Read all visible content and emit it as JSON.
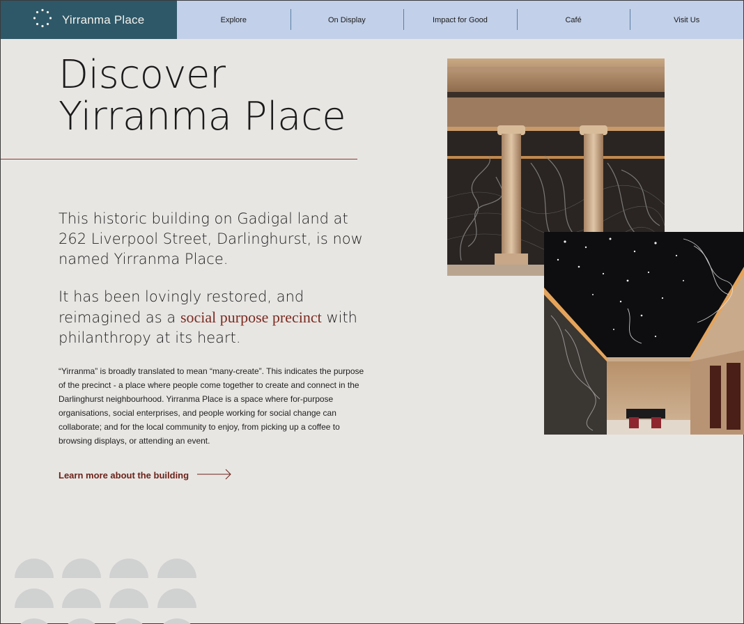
{
  "header": {
    "brand_name": "Yirranma Place",
    "nav": [
      "Explore",
      "On Display",
      "Impact for Good",
      "Café",
      "Visit Us"
    ]
  },
  "hero": {
    "title_line1": "Discover",
    "title_line2": "Yirranma Place"
  },
  "lead1": "This historic building on Gadigal land at 262 Liverpool Street, Darlinghurst, is now named Yirranma Place.",
  "lead2": {
    "before": "It has been lovingly restored, and reimagined as a ",
    "highlight": "social purpose precinct",
    "after": " with philanthropy at its heart."
  },
  "body_text": "“Yirranma” is broadly translated to mean “many-create”. This indicates the purpose of the precinct - a place where people come together to create and connect in the Darlinghurst neighbourhood. Yirranma Place is a space where for-purpose organisations, social enterprises, and people working for social change can collaborate; and for the local community to enjoy, from picking up a coffee to browsing displays, or attending an event.",
  "learn_more": "Learn more about the building",
  "icons": {
    "brand_logo": "dotted-circle-logo-icon",
    "link_arrow": "arrow-right-icon"
  },
  "colors": {
    "brand_bg": "#2e5868",
    "nav_bg": "#c2d0e9",
    "page_bg": "#e8e6e3",
    "accent": "#7b2a20"
  }
}
